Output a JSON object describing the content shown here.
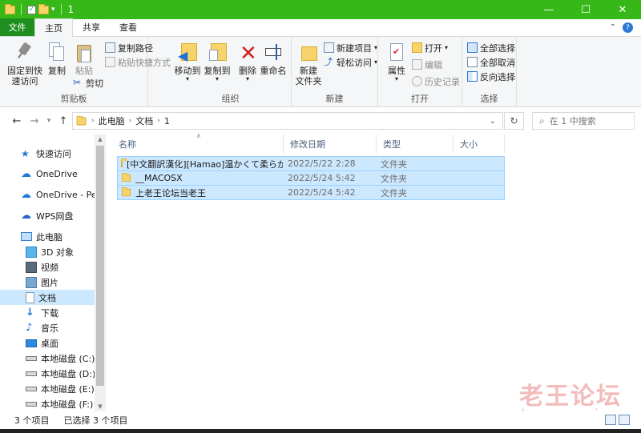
{
  "window": {
    "title": "1",
    "minimize": "—",
    "maximize": "☐",
    "close": "✕",
    "accent_color": "#36b918"
  },
  "ribbon_tabs": {
    "file": "文件",
    "home": "主页",
    "share": "共享",
    "view": "查看"
  },
  "ribbon": {
    "clipboard": {
      "label": "剪贴板",
      "pin_quick_access": "固定到快\n速访问",
      "copy": "复制",
      "paste": "粘贴",
      "copy_path": "复制路径",
      "paste_shortcut": "粘贴快捷方式",
      "cut": "剪切"
    },
    "organize": {
      "label": "组织",
      "move_to": "移动到",
      "copy_to": "复制到",
      "delete": "删除",
      "rename": "重命名"
    },
    "new": {
      "label": "新建",
      "new_folder": "新建\n文件夹",
      "new_item": "新建项目",
      "easy_access": "轻松访问"
    },
    "open": {
      "label": "打开",
      "properties": "属性",
      "open": "打开",
      "edit": "编辑",
      "history": "历史记录"
    },
    "select": {
      "label": "选择",
      "select_all": "全部选择",
      "select_none": "全部取消",
      "invert": "反向选择"
    }
  },
  "address": {
    "crumbs": [
      "此电脑",
      "文档",
      "1"
    ],
    "search_placeholder": "在 1 中搜索"
  },
  "sidebar": {
    "items": [
      {
        "label": "快速访问",
        "icon": "star-icon"
      },
      {
        "label": "OneDrive",
        "icon": "cloud-icon"
      },
      {
        "label": "OneDrive - Pers",
        "icon": "cloud-icon"
      },
      {
        "label": "WPS网盘",
        "icon": "cloud-icon"
      },
      {
        "label": "此电脑",
        "icon": "computer-icon"
      },
      {
        "label": "3D 对象",
        "icon": "cube-icon"
      },
      {
        "label": "视频",
        "icon": "video-icon"
      },
      {
        "label": "图片",
        "icon": "picture-icon"
      },
      {
        "label": "文档",
        "icon": "document-icon"
      },
      {
        "label": "下载",
        "icon": "download-icon"
      },
      {
        "label": "音乐",
        "icon": "music-icon"
      },
      {
        "label": "桌面",
        "icon": "desktop-icon"
      },
      {
        "label": "本地磁盘 (C:)",
        "icon": "drive-icon"
      },
      {
        "label": "本地磁盘 (D:)",
        "icon": "drive-icon"
      },
      {
        "label": "本地磁盘 (E:)",
        "icon": "drive-icon"
      },
      {
        "label": "本地磁盘 (F:)",
        "icon": "drive-icon"
      }
    ]
  },
  "columns": {
    "name": "名称",
    "modified": "修改日期",
    "type": "类型",
    "size": "大小"
  },
  "files": [
    {
      "name": "[中文翻訳漢化][Hamao]温かくて柔らか...",
      "modified": "2022/5/22 2:28",
      "type": "文件夹"
    },
    {
      "name": "__MACOSX",
      "modified": "2022/5/24 5:42",
      "type": "文件夹"
    },
    {
      "name": "上老王论坛当老王",
      "modified": "2022/5/24 5:42",
      "type": "文件夹"
    }
  ],
  "status": {
    "count": "3 个项目",
    "selected": "已选择 3 个项目"
  },
  "watermark": {
    "cn": "老王论坛",
    "en": "laowang.vip"
  }
}
